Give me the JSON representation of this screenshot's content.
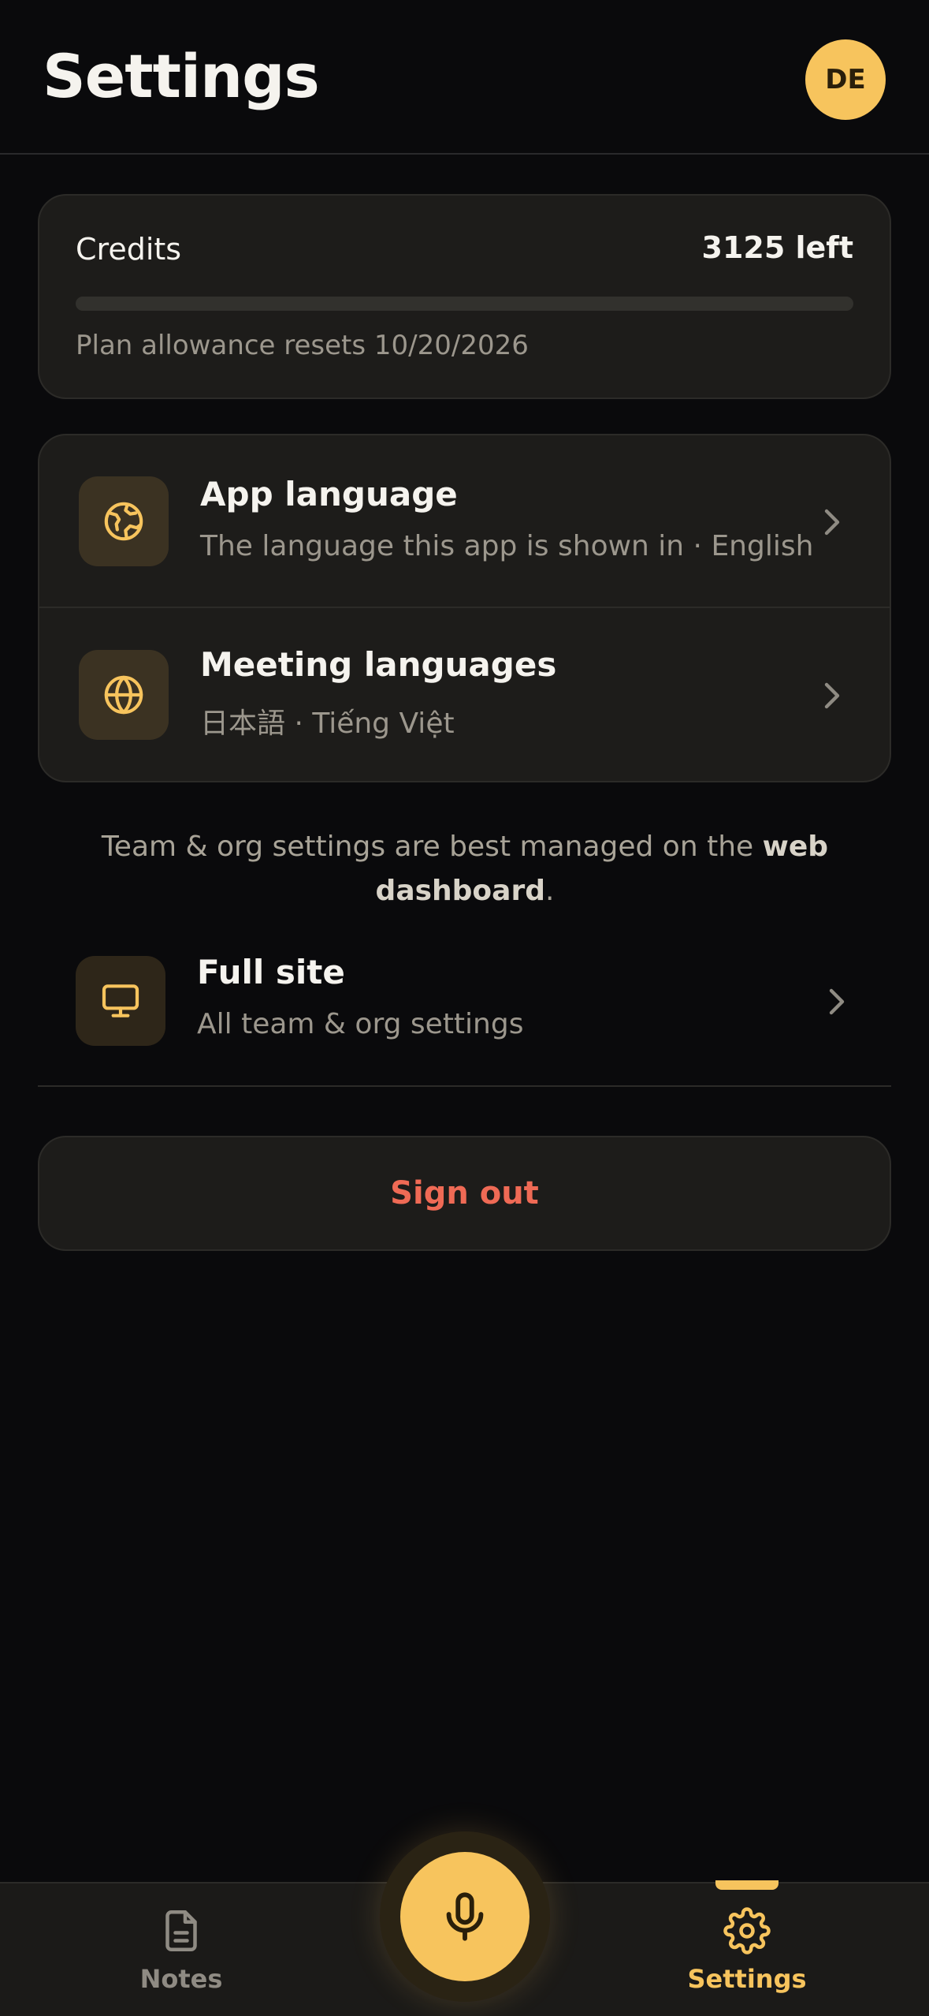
{
  "header": {
    "title": "Settings",
    "avatar_initials": "DE"
  },
  "credits": {
    "label": "Credits",
    "remaining": "3125 left",
    "used_fraction": 0,
    "reset_text": "Plan allowance resets 10/20/2026"
  },
  "languages": {
    "app": {
      "title": "App language",
      "subtitle": "The language this app is shown in · English",
      "icon": "earth-icon"
    },
    "meeting": {
      "title": "Meeting languages",
      "subtitle": "日本語 · Tiếng Việt",
      "icon": "globe-icon"
    }
  },
  "note": {
    "prefix": "Team & org settings are best managed on the ",
    "bold": "web dashboard",
    "suffix": "."
  },
  "full_site": {
    "title": "Full site",
    "subtitle": "All team & org settings",
    "icon": "monitor-icon"
  },
  "signout": {
    "label": "Sign out"
  },
  "tabbar": {
    "notes_label": "Notes",
    "settings_label": "Settings",
    "active": "Settings"
  },
  "colors": {
    "accent": "#f7c45d",
    "danger": "#ef6a55",
    "background": "#0a0a0c",
    "card": "#1d1c1a"
  }
}
